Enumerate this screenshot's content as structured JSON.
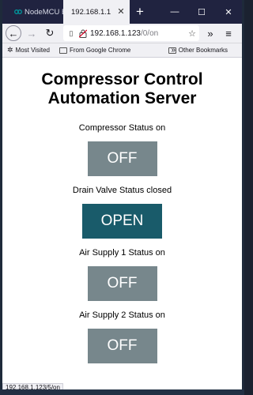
{
  "browser": {
    "tabs": [
      {
        "label": "NodeMCU ESP",
        "active": false
      },
      {
        "label": "192.168.1.1",
        "active": true
      }
    ],
    "url": {
      "host": "192.168.1.123",
      "path": "/0/on"
    },
    "bookmarks": [
      "Most Visited",
      "From Google Chrome"
    ],
    "other_bookmarks": "Other Bookmarks",
    "status_url": "192.168.1.123/5/on"
  },
  "page": {
    "title_line1": "Compressor Control",
    "title_line2": "Automation Server",
    "controls": [
      {
        "status": "Compressor Status on",
        "button": "OFF"
      },
      {
        "status": "Drain Valve Status closed",
        "button": "OPEN"
      },
      {
        "status": "Air Supply 1 Status on",
        "button": "OFF"
      },
      {
        "status": "Air Supply 2 Status on",
        "button": "OFF"
      }
    ]
  },
  "colors": {
    "button_off": "#77878c",
    "button_open": "#195b6a",
    "tabbar": "#202340"
  }
}
